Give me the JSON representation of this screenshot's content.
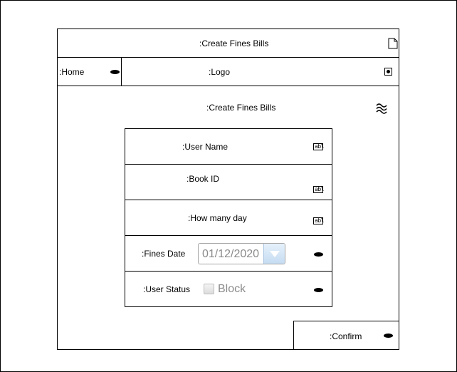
{
  "header": {
    "title": ":Create Fines Bills",
    "icon": "document-icon"
  },
  "nav": {
    "home_label": ":Home",
    "logo_label": ":Logo"
  },
  "section": {
    "title": ":Create Fines Bills",
    "icon": "approx-wave-icon"
  },
  "form": {
    "user_name_label": ":User Name",
    "book_id_label": ":Book ID",
    "how_many_day_label": ":How many day",
    "textfield_icon_text": "abl",
    "fines_date_label": ":Fines Date",
    "fines_date_value": "01/12/2020",
    "user_status_label": ":User Status",
    "block_label": "Block",
    "block_checked": false
  },
  "confirm": {
    "label": ":Confirm"
  }
}
